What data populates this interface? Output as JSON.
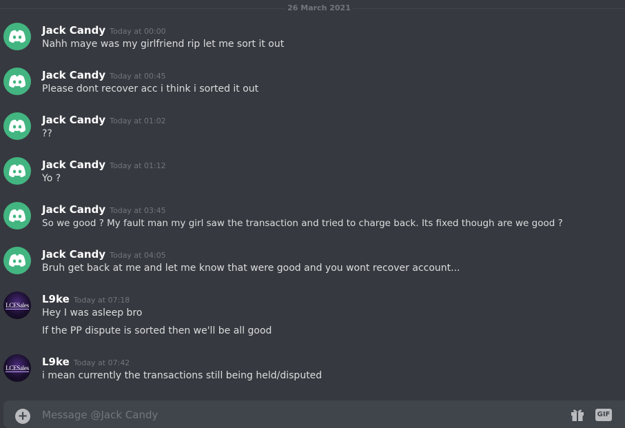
{
  "date_divider": "26 March 2021",
  "users": {
    "jack": {
      "name": "Jack Candy",
      "avatar_icon": "discord-logo-icon",
      "avatar_color": "#43b581"
    },
    "l9ke": {
      "name": "L9ke",
      "avatar_text": "LCESales"
    }
  },
  "messages": [
    {
      "author": "Jack Candy",
      "timestamp": "Today at 00:00",
      "lines": [
        "Nahh maye was my girlfriend rip let me sort it out"
      ]
    },
    {
      "author": "Jack Candy",
      "timestamp": "Today at 00:45",
      "lines": [
        "Please dont recover acc i think i sorted it out"
      ]
    },
    {
      "author": "Jack Candy",
      "timestamp": "Today at 01:02",
      "lines": [
        "??"
      ]
    },
    {
      "author": "Jack Candy",
      "timestamp": "Today at 01:12",
      "lines": [
        "Yo ?"
      ]
    },
    {
      "author": "Jack Candy",
      "timestamp": "Today at 03:45",
      "lines": [
        "So we good ? My fault man my girl saw the transaction and tried to charge back. Its fixed though are we good ?"
      ]
    },
    {
      "author": "Jack Candy",
      "timestamp": "Today at 04:05",
      "lines": [
        "Bruh get back at me and let me know that were good and you wont recover account..."
      ]
    },
    {
      "author": "L9ke",
      "timestamp": "Today at 07:18",
      "lines": [
        "Hey I was asleep bro",
        "If the PP dispute is sorted then we'll be all good"
      ]
    },
    {
      "author": "L9ke",
      "timestamp": "Today at 07:42",
      "lines": [
        "i mean currently the transactions still being held/disputed"
      ]
    }
  ],
  "composer": {
    "placeholder": "Message @Jack Candy",
    "gif_label": "GIF",
    "icons": [
      "plus-icon",
      "gift-icon",
      "gif-icon"
    ]
  },
  "colors": {
    "background": "#36393f",
    "username": "#ffffff",
    "timestamp": "#72767d",
    "message_text": "#dcddde",
    "composer_bg": "#40444b"
  }
}
